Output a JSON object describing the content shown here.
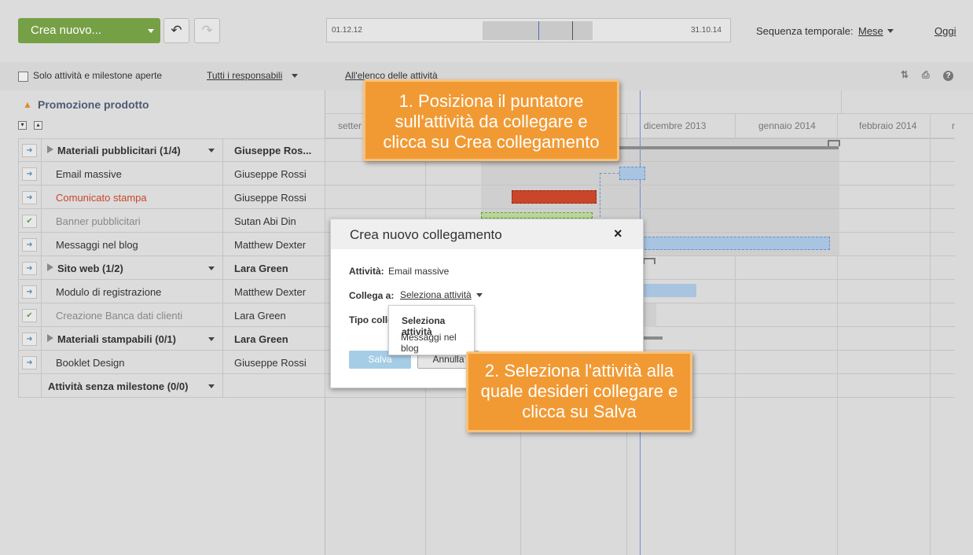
{
  "toolbar": {
    "create_label": "Crea nuovo...",
    "undo_icon": "undo-icon",
    "redo_icon": "redo-icon",
    "timeline_start": "01.12.12",
    "timeline_end": "31.10.14",
    "seq_label": "Sequenza temporale:",
    "seq_value": "Mese",
    "today": "Oggi"
  },
  "filters": {
    "open_only": "Solo attività e milestone aperte",
    "responsible": "Tutti i responsabili",
    "all_list": "All'elenco delle attività"
  },
  "project": {
    "title": "Promozione prodotto"
  },
  "months": [
    "setter",
    "dicembre 2013",
    "gennaio 2014",
    "febbraio 2014",
    "r"
  ],
  "rows": [
    {
      "name": "Materiali pubblicitari (1/4)",
      "resp": "Giuseppe Ros..."
    },
    {
      "name": "Email massive",
      "resp": "Giuseppe Rossi"
    },
    {
      "name": "Comunicato stampa",
      "resp": "Giuseppe Rossi"
    },
    {
      "name": "Banner pubblicitari",
      "resp": "Sutan Abi Din"
    },
    {
      "name": "Messaggi nel blog",
      "resp": "Matthew Dexter"
    },
    {
      "name": "Sito web (1/2)",
      "resp": "Lara Green"
    },
    {
      "name": "Modulo di registrazione",
      "resp": "Matthew Dexter"
    },
    {
      "name": "Creazione Banca dati clienti",
      "resp": "Lara Green"
    },
    {
      "name": "Materiali stampabili (0/1)",
      "resp": "Lara Green"
    },
    {
      "name": "Booklet Design",
      "resp": "Giuseppe Rossi"
    },
    {
      "name": "Attività senza milestone (0/0)",
      "resp": ""
    }
  ],
  "colors": {
    "accent_green": "#76a046",
    "late_red": "#c9462a",
    "callout_orange": "#f19a34",
    "bar_blue": "#a8c4e0"
  },
  "dialog": {
    "title": "Crea nuovo collegamento",
    "close": "×",
    "task_label": "Attività:",
    "task_value": "Email massive",
    "link_label": "Collega a:",
    "link_value": "Seleziona attività",
    "type_label": "Tipo colle",
    "save": "Salva",
    "cancel": "Annulla"
  },
  "dropdown": {
    "header": "Seleziona attività",
    "option": "Messaggi nel blog"
  },
  "callouts": {
    "one": "1. Posiziona il puntatore sull'attività da collegare e clicca su Crea collegamento",
    "two": "2. Seleziona l'attività alla quale desideri collegare e clicca su Salva"
  }
}
